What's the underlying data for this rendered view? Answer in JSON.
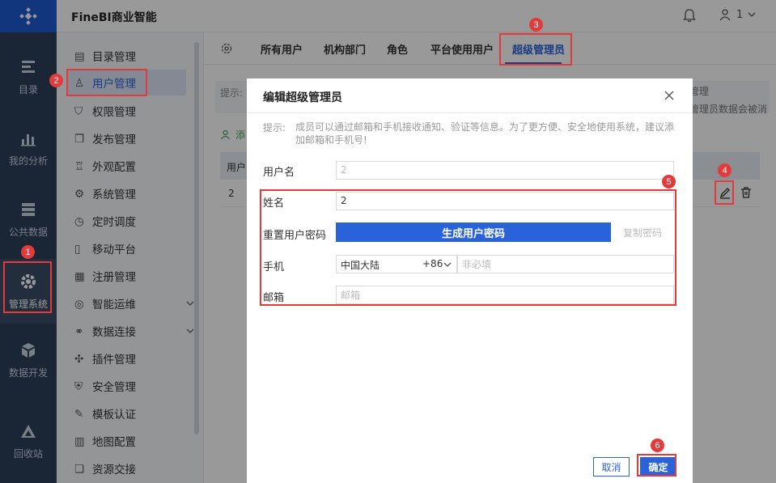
{
  "app": {
    "title": "FineBI商业智能"
  },
  "header": {
    "user": "1"
  },
  "rail": {
    "items": [
      {
        "label": "目录",
        "icon": "catalog-icon"
      },
      {
        "label": "我的分析",
        "icon": "chart-icon"
      },
      {
        "label": "公共数据",
        "icon": "database-icon"
      },
      {
        "label": "管理系统",
        "icon": "gear-icon"
      },
      {
        "label": "数据开发",
        "icon": "cube-icon"
      },
      {
        "label": "回收站",
        "icon": "recycle-icon"
      }
    ]
  },
  "sidebar": {
    "items": [
      {
        "label": "目录管理"
      },
      {
        "label": "用户管理"
      },
      {
        "label": "权限管理"
      },
      {
        "label": "发布管理"
      },
      {
        "label": "外观配置"
      },
      {
        "label": "系统管理"
      },
      {
        "label": "定时调度"
      },
      {
        "label": "移动平台"
      },
      {
        "label": "注册管理"
      },
      {
        "label": "智能运维"
      },
      {
        "label": "数据连接"
      },
      {
        "label": "插件管理"
      },
      {
        "label": "安全管理"
      },
      {
        "label": "模板认证"
      },
      {
        "label": "地图配置"
      },
      {
        "label": "资源交接"
      }
    ]
  },
  "tabs": [
    {
      "label": "所有用户"
    },
    {
      "label": "机构部门"
    },
    {
      "label": "角色"
    },
    {
      "label": "平台使用用户"
    },
    {
      "label": "超级管理员"
    }
  ],
  "background": {
    "hint": "提示:",
    "add_user": "添",
    "table_header": "用户",
    "row_value": "2",
    "peek_line1": "管理",
    "peek_line2": "管理员数据会被消"
  },
  "dialog": {
    "title": "编辑超级管理员",
    "hint_label": "提示:",
    "hint_text": "成员可以通过邮箱和手机接收通知、验证等信息。为了更方便、安全地使用系统，建议添加邮箱和手机号!",
    "fields": {
      "username_label": "用户名",
      "username_value": "2",
      "name_label": "姓名",
      "name_value": "2",
      "password_label": "重置用户密码",
      "generate_button": "生成用户密码",
      "copy_password": "复制密码",
      "phone_label": "手机",
      "country": "中国大陆",
      "country_code": "+86",
      "phone_placeholder": "非必填",
      "email_label": "邮箱",
      "email_placeholder": "邮箱"
    },
    "cancel": "取消",
    "confirm": "确定"
  },
  "annotations": {
    "color": "#e23b3b",
    "badges": [
      "1",
      "2",
      "3",
      "4",
      "5",
      "6"
    ]
  },
  "colors": {
    "accent": "#2a63d9",
    "rail": "#2c3e59"
  }
}
